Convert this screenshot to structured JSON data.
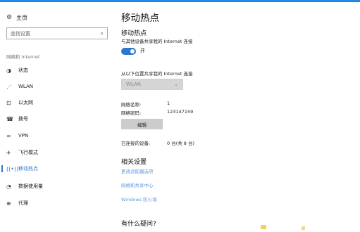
{
  "sidebar": {
    "home": {
      "icon": "home-icon",
      "label": "主页"
    },
    "search": {
      "placeholder": "查找设置",
      "icon": "search-icon"
    },
    "section_label": "网络和 Internet",
    "items": [
      {
        "icon": "status-icon",
        "label": "状态",
        "active": false
      },
      {
        "icon": "wlan-icon",
        "label": "WLAN",
        "active": false
      },
      {
        "icon": "ethernet-icon",
        "label": "以太网",
        "active": false
      },
      {
        "icon": "dialup-icon",
        "label": "拨号",
        "active": false
      },
      {
        "icon": "vpn-icon",
        "label": "VPN",
        "active": false
      },
      {
        "icon": "airplane-icon",
        "label": "飞行模式",
        "active": false
      },
      {
        "icon": "hotspot-icon",
        "label": "移动热点",
        "active": true
      },
      {
        "icon": "data-usage-icon",
        "label": "数据使用量",
        "active": false
      },
      {
        "icon": "proxy-icon",
        "label": "代理",
        "active": false
      }
    ]
  },
  "main": {
    "title": "移动热点",
    "hotspot": {
      "heading": "移动热点",
      "description": "与其他设备共享我的 Internet 连接",
      "toggle_state": "开",
      "toggle_on": true
    },
    "share_from": {
      "label": "从以下位置共享我的 Internet 连接",
      "selected": "WLAN"
    },
    "network_name_label": "网络名称:",
    "network_name_value": "1",
    "network_password_label": "网络密码:",
    "network_password_value": "123147159",
    "edit_button": "编辑",
    "connected_label": "已连接的设备:",
    "connected_value": "0 台(共 8 台)",
    "related": {
      "heading": "相关设置",
      "links": [
        "更改适配器选项",
        "网络和共享中心",
        "Windows 防火墙"
      ]
    },
    "faq_heading": "有什么疑问?"
  },
  "colors": {
    "accent": "#2b78d1",
    "link": "#5c9ce0",
    "top_strip": "#1e88e5"
  }
}
